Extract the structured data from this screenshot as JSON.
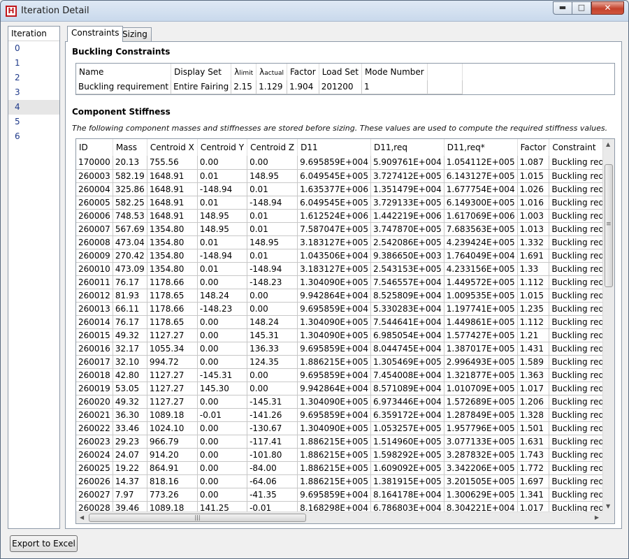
{
  "window": {
    "title": "Iteration Detail",
    "icon_letter": "H",
    "controls": {
      "minimize": "▬",
      "maximize": "□",
      "close": "✕"
    }
  },
  "iterations": {
    "header": "Iteration",
    "items": [
      "0",
      "1",
      "2",
      "3",
      "4",
      "5",
      "6"
    ],
    "selected": "4"
  },
  "tabs": [
    "Constraints",
    "Sizing"
  ],
  "buckling": {
    "title": "Buckling Constraints",
    "columns": {
      "name": "Name",
      "display_set": "Display Set",
      "lambda": "λ",
      "limit_sub": "limit",
      "actual_sub": "actual",
      "factor": "Factor",
      "load_set": "Load Set",
      "mode_number": "Mode Number"
    },
    "rows": [
      [
        "Buckling requirement",
        "Entire Fairing",
        "2.15",
        "1.129",
        "1.904",
        "201200",
        "1"
      ]
    ]
  },
  "stiffness": {
    "title": "Component Stiffness",
    "note": "The following component masses and stiffnesses are stored before sizing. These values are used to compute the required stiffness values.",
    "columns": [
      "ID",
      "Mass",
      "Centroid X",
      "Centroid Y",
      "Centroid Z",
      "D11",
      "D11,req",
      "D11,req*",
      "Factor",
      "Constraint"
    ],
    "rows": [
      [
        "170000",
        "20.13",
        "755.56",
        "0.00",
        "0.00",
        "9.695859E+004",
        "5.909761E+004",
        "1.054112E+005",
        "1.087",
        "Buckling requirement, Mode"
      ],
      [
        "260003",
        "582.19",
        "1648.91",
        "0.01",
        "148.95",
        "6.049545E+005",
        "3.727412E+005",
        "6.143127E+005",
        "1.015",
        "Buckling requirement, Mode"
      ],
      [
        "260004",
        "325.86",
        "1648.91",
        "-148.94",
        "0.01",
        "1.635377E+006",
        "1.351479E+004",
        "1.677754E+004",
        "1.026",
        "Buckling requirement, Mode"
      ],
      [
        "260005",
        "582.25",
        "1648.91",
        "0.01",
        "-148.94",
        "6.049545E+005",
        "3.729133E+005",
        "6.149300E+005",
        "1.016",
        "Buckling requirement, Mode"
      ],
      [
        "260006",
        "748.53",
        "1648.91",
        "148.95",
        "0.01",
        "1.612524E+006",
        "1.442219E+006",
        "1.617069E+006",
        "1.003",
        "Buckling requirement, Mode"
      ],
      [
        "260007",
        "567.69",
        "1354.80",
        "148.95",
        "0.01",
        "7.587047E+005",
        "3.747870E+005",
        "7.683563E+005",
        "1.013",
        "Buckling requirement, Mode"
      ],
      [
        "260008",
        "473.04",
        "1354.80",
        "0.01",
        "148.95",
        "3.183127E+005",
        "2.542086E+005",
        "4.239424E+005",
        "1.332",
        "Buckling requirement, Mode"
      ],
      [
        "260009",
        "270.42",
        "1354.80",
        "-148.94",
        "0.01",
        "1.043506E+004",
        "9.386650E+003",
        "1.764049E+004",
        "1.691",
        "Buckling requirement, Mode"
      ],
      [
        "260010",
        "473.09",
        "1354.80",
        "0.01",
        "-148.94",
        "3.183127E+005",
        "2.543153E+005",
        "4.233156E+005",
        "1.33",
        "Buckling requirement, Mode"
      ],
      [
        "260011",
        "76.17",
        "1178.66",
        "0.00",
        "-148.23",
        "1.304090E+005",
        "7.546557E+004",
        "1.449572E+005",
        "1.112",
        "Buckling requirement, Mode"
      ],
      [
        "260012",
        "81.93",
        "1178.65",
        "148.24",
        "0.00",
        "9.942864E+004",
        "8.525809E+004",
        "1.009535E+005",
        "1.015",
        "Buckling requirement, Mode"
      ],
      [
        "260013",
        "66.11",
        "1178.66",
        "-148.23",
        "0.00",
        "9.695859E+004",
        "5.330283E+004",
        "1.197741E+005",
        "1.235",
        "Buckling requirement, Mode"
      ],
      [
        "260014",
        "76.17",
        "1178.65",
        "0.00",
        "148.24",
        "1.304090E+005",
        "7.544641E+004",
        "1.449861E+005",
        "1.112",
        "Buckling requirement, Mode"
      ],
      [
        "260015",
        "49.32",
        "1127.27",
        "0.00",
        "145.31",
        "1.304090E+005",
        "6.985054E+004",
        "1.577427E+005",
        "1.21",
        "Buckling requirement, Mode"
      ],
      [
        "260016",
        "32.17",
        "1055.34",
        "0.00",
        "136.33",
        "9.695859E+004",
        "8.044745E+004",
        "1.387017E+005",
        "1.431",
        "Buckling requirement, Mode"
      ],
      [
        "260017",
        "32.10",
        "994.72",
        "0.00",
        "124.35",
        "1.886215E+005",
        "1.305469E+005",
        "2.996493E+005",
        "1.589",
        "Buckling requirement, Mode"
      ],
      [
        "260018",
        "42.80",
        "1127.27",
        "-145.31",
        "0.00",
        "9.695859E+004",
        "7.454008E+004",
        "1.321877E+005",
        "1.363",
        "Buckling requirement, Mode"
      ],
      [
        "260019",
        "53.05",
        "1127.27",
        "145.30",
        "0.00",
        "9.942864E+004",
        "8.571089E+004",
        "1.010709E+005",
        "1.017",
        "Buckling requirement, Mode"
      ],
      [
        "260020",
        "49.32",
        "1127.27",
        "0.00",
        "-145.31",
        "1.304090E+005",
        "6.973446E+004",
        "1.572689E+005",
        "1.206",
        "Buckling requirement, Mode"
      ],
      [
        "260021",
        "36.30",
        "1089.18",
        "-0.01",
        "-141.26",
        "9.695859E+004",
        "6.359172E+004",
        "1.287849E+005",
        "1.328",
        "Buckling requirement, Mode"
      ],
      [
        "260022",
        "33.46",
        "1024.10",
        "0.00",
        "-130.67",
        "1.304090E+005",
        "1.053257E+005",
        "1.957796E+005",
        "1.501",
        "Buckling requirement, Mode"
      ],
      [
        "260023",
        "29.23",
        "966.79",
        "0.00",
        "-117.41",
        "1.886215E+005",
        "1.514960E+005",
        "3.077133E+005",
        "1.631",
        "Buckling requirement, Mode"
      ],
      [
        "260024",
        "24.07",
        "914.20",
        "0.00",
        "-101.80",
        "1.886215E+005",
        "1.598292E+005",
        "3.287832E+005",
        "1.743",
        "Buckling requirement, Mode"
      ],
      [
        "260025",
        "19.22",
        "864.91",
        "0.00",
        "-84.00",
        "1.886215E+005",
        "1.609092E+005",
        "3.342206E+005",
        "1.772",
        "Buckling requirement, Mode"
      ],
      [
        "260026",
        "14.37",
        "818.16",
        "0.00",
        "-64.06",
        "1.886215E+005",
        "1.381915E+005",
        "3.201505E+005",
        "1.697",
        "Buckling requirement, Mode"
      ],
      [
        "260027",
        "7.97",
        "773.26",
        "0.00",
        "-41.35",
        "9.695859E+004",
        "8.164178E+004",
        "1.300629E+005",
        "1.341",
        "Buckling requirement, Mode"
      ],
      [
        "260028",
        "39.46",
        "1089.18",
        "141.25",
        "-0.01",
        "8.168298E+004",
        "6.786803E+004",
        "8.304221E+004",
        "1.017",
        "Buckling requirement, Mode"
      ]
    ]
  },
  "footer": {
    "export_label": "Export to Excel"
  }
}
